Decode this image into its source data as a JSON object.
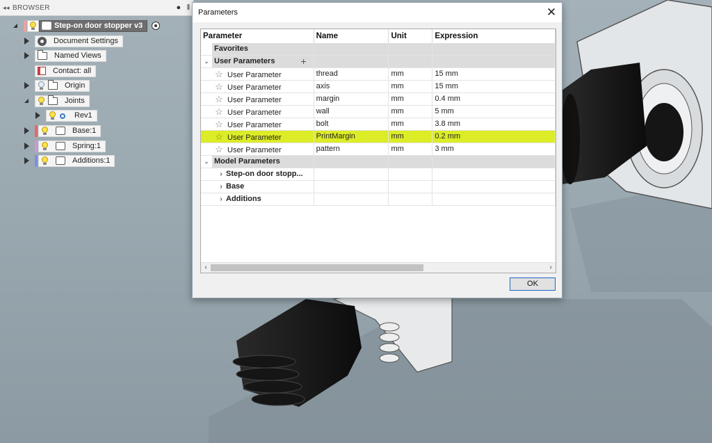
{
  "browser": {
    "header": "BROWSER",
    "root": "Step-on door stopper v3",
    "items": {
      "document_settings": "Document Settings",
      "named_views": "Named Views",
      "contact": "Contact: all",
      "origin": "Origin",
      "joints": "Joints",
      "rev1": "Rev1",
      "base": "Base:1",
      "spring": "Spring:1",
      "additions": "Additions:1"
    },
    "colors": {
      "base": "#e06c6c",
      "spring": "#c79ad6",
      "additions": "#7f8fdc",
      "root": "#f1a0a0"
    }
  },
  "dialog": {
    "title": "Parameters",
    "close_symbol": "✕",
    "columns": [
      "Parameter",
      "Name",
      "Unit",
      "Expression"
    ],
    "favorites": "Favorites",
    "user_section": "User Parameters",
    "add_symbol": "+",
    "user_params": [
      {
        "type": "User Parameter",
        "name": "thread",
        "unit": "mm",
        "expression": "15 mm"
      },
      {
        "type": "User Parameter",
        "name": "axis",
        "unit": "mm",
        "expression": "15 mm"
      },
      {
        "type": "User Parameter",
        "name": "margin",
        "unit": "mm",
        "expression": "0.4 mm"
      },
      {
        "type": "User Parameter",
        "name": "wall",
        "unit": "mm",
        "expression": "5 mm"
      },
      {
        "type": "User Parameter",
        "name": "bolt",
        "unit": "mm",
        "expression": "3.8 mm"
      },
      {
        "type": "User Parameter",
        "name": "PrintMargin",
        "unit": "mm",
        "expression": "0.2 mm"
      },
      {
        "type": "User Parameter",
        "name": "pattern",
        "unit": "mm",
        "expression": "3 mm"
      }
    ],
    "highlight_color": "#dcec26",
    "model_section": "Model Parameters",
    "model_children": [
      "Step-on door stopp...",
      "Base",
      "Additions"
    ],
    "ok_label": "OK"
  }
}
